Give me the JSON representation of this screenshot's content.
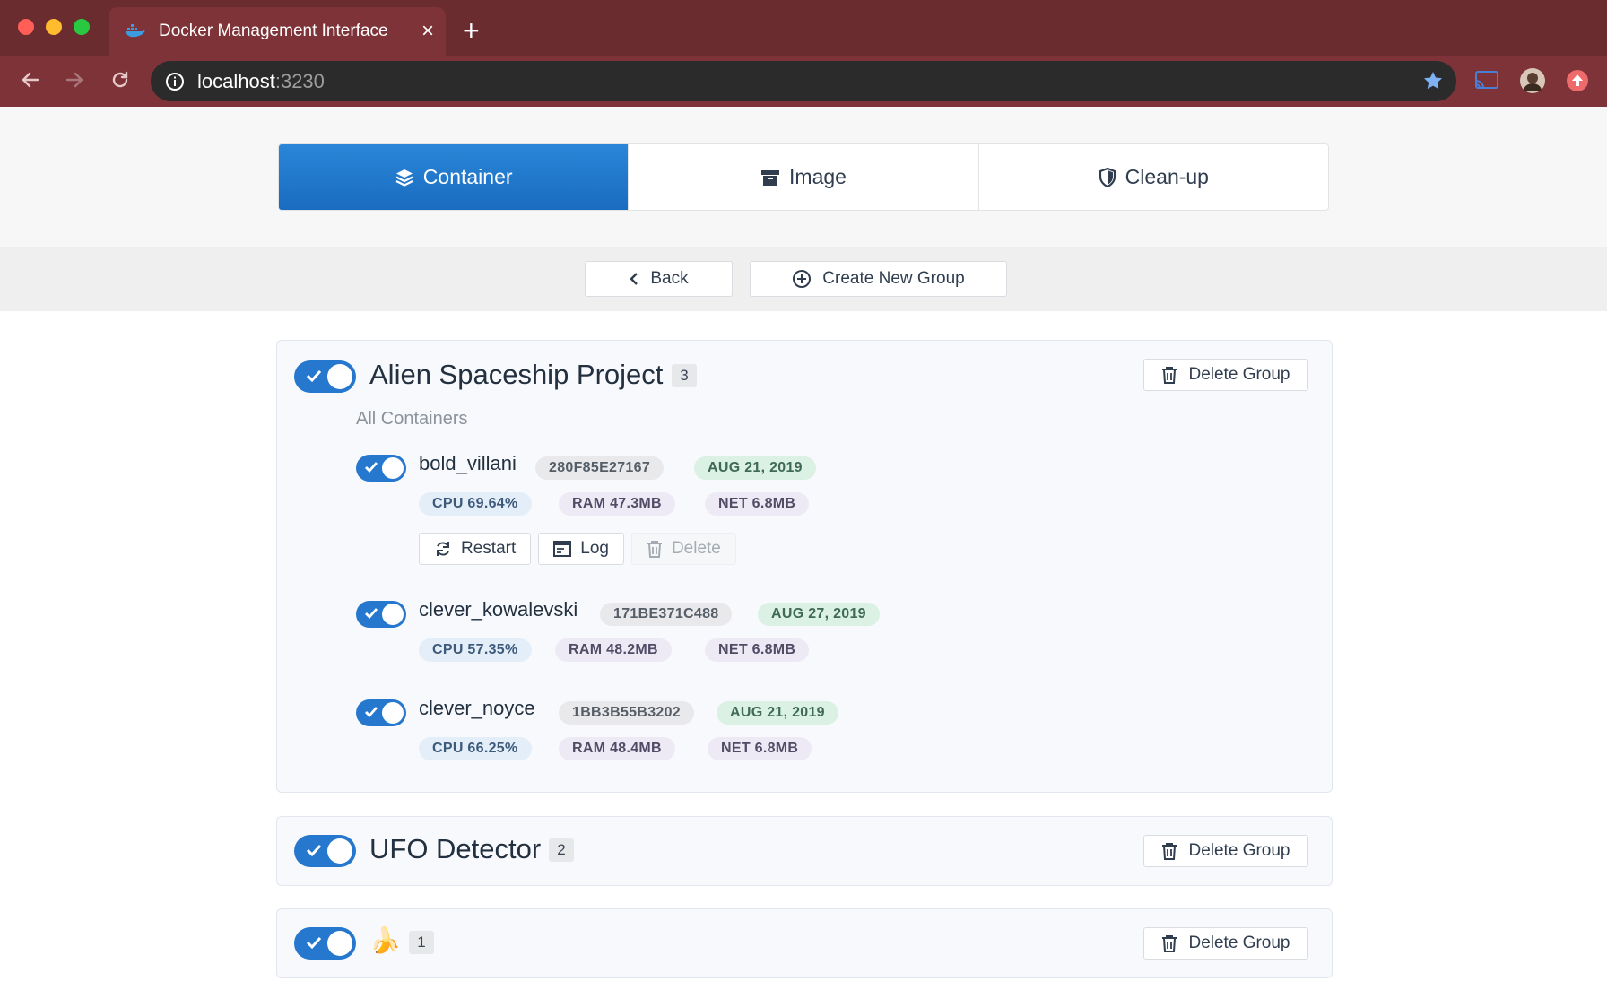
{
  "browser": {
    "tab_title": "Docker Management Interface",
    "close_glyph": "×",
    "new_tab_glyph": "+",
    "url_host": "localhost",
    "url_port": ":3230"
  },
  "nav": {
    "tabs": [
      {
        "label": "Container",
        "icon": "layers-icon",
        "active": true
      },
      {
        "label": "Image",
        "icon": "archive-icon",
        "active": false
      },
      {
        "label": "Clean-up",
        "icon": "shield-icon",
        "active": false
      }
    ]
  },
  "actions": {
    "back_label": "Back",
    "create_group_label": "Create New Group"
  },
  "groups": [
    {
      "title": "Alien Spaceship Project",
      "count": "3",
      "enabled": true,
      "expanded": true,
      "section_label": "All Containers",
      "delete_label": "Delete Group",
      "containers": [
        {
          "name": "bold_villani",
          "id": "280F85E27167",
          "date": "AUG 21, 2019",
          "cpu": "CPU 69.64%",
          "ram": "RAM 47.3MB",
          "net": "NET 6.8MB",
          "enabled": true,
          "actions": {
            "restart": "Restart",
            "log": "Log",
            "delete": "Delete"
          }
        },
        {
          "name": "clever_kowalevski",
          "id": "171BE371C488",
          "date": "AUG 27, 2019",
          "cpu": "CPU 57.35%",
          "ram": "RAM 48.2MB",
          "net": "NET 6.8MB",
          "enabled": true
        },
        {
          "name": "clever_noyce",
          "id": "1BB3B55B3202",
          "date": "AUG 21, 2019",
          "cpu": "CPU 66.25%",
          "ram": "RAM 48.4MB",
          "net": "NET 6.8MB",
          "enabled": true
        }
      ]
    },
    {
      "title": "UFO Detector",
      "count": "2",
      "enabled": true,
      "expanded": false,
      "delete_label": "Delete Group"
    },
    {
      "title": "🍌",
      "count": "1",
      "enabled": true,
      "expanded": false,
      "delete_label": "Delete Group"
    }
  ],
  "colors": {
    "accent": "#1a6cc0",
    "chrome": "#6b2c2f",
    "date_tag": "#daf1e4",
    "cpu_tag": "#e3eef9"
  }
}
